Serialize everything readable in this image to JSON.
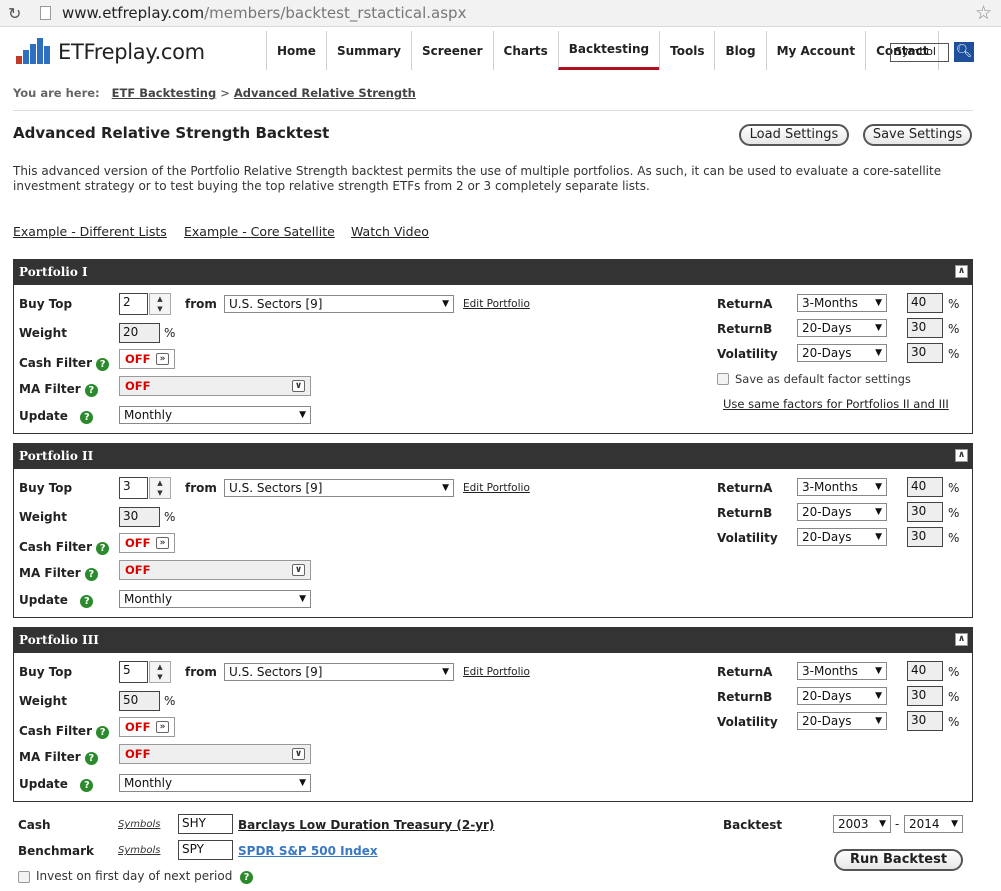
{
  "browser": {
    "url_host": "www.etfreplay.com",
    "url_path": "/members/backtest_rstactical.aspx"
  },
  "header": {
    "logo_text": "ETFreplay.com",
    "nav": [
      "Home",
      "Summary",
      "Screener",
      "Charts",
      "Backtesting",
      "Tools",
      "Blog",
      "My Account",
      "Contact"
    ],
    "active_nav": "Backtesting",
    "symbol_value": "Symbol"
  },
  "breadcrumb": {
    "prefix": "You are here:",
    "item1": "ETF Backtesting",
    "sep": ">",
    "item2": "Advanced Relative Strength"
  },
  "page": {
    "title": "Advanced Relative Strength Backtest",
    "load_label": "Load Settings",
    "save_label": "Save Settings",
    "description": "This advanced version of the Portfolio Relative Strength backtest permits the use of multiple portfolios. As such, it can be used to evaluate a core-satellite investment strategy or to test buying the top relative strength ETFs from 2 or 3 completely separate lists.",
    "example1": "Example - Different Lists",
    "example2": "Example - Core Satellite",
    "video": "Watch Video"
  },
  "labels": {
    "buy_top": "Buy Top",
    "from": "from",
    "weight": "Weight",
    "cash_filter": "Cash Filter",
    "ma_filter": "MA Filter",
    "update": "Update",
    "edit_portfolio": "Edit Portfolio",
    "returnA": "ReturnA",
    "returnB": "ReturnB",
    "volatility": "Volatility",
    "pct": "%",
    "off": "OFF",
    "save_default": "Save as default factor settings",
    "use_same": "Use same factors for Portfolios II and III"
  },
  "portfolios": [
    {
      "name": "Portfolio I",
      "buy_top": "2",
      "list": "U.S. Sectors [9]",
      "weight": "20",
      "update": "Monthly",
      "returnA_period": "3-Months",
      "returnA_weight": "40",
      "returnB_period": "20-Days",
      "returnB_weight": "30",
      "vol_period": "20-Days",
      "vol_weight": "30"
    },
    {
      "name": "Portfolio II",
      "buy_top": "3",
      "list": "U.S. Sectors [9]",
      "weight": "30",
      "update": "Monthly",
      "returnA_period": "3-Months",
      "returnA_weight": "40",
      "returnB_period": "20-Days",
      "returnB_weight": "30",
      "vol_period": "20-Days",
      "vol_weight": "30"
    },
    {
      "name": "Portfolio III",
      "buy_top": "5",
      "list": "U.S. Sectors [9]",
      "weight": "50",
      "update": "Monthly",
      "returnA_period": "3-Months",
      "returnA_weight": "40",
      "returnB_period": "20-Days",
      "returnB_weight": "30",
      "vol_period": "20-Days",
      "vol_weight": "30"
    }
  ],
  "bottom": {
    "cash_label": "Cash",
    "benchmark_label": "Benchmark",
    "symbols_link": "Symbols",
    "cash_symbol": "SHY",
    "cash_name": "Barclays Low Duration Treasury (2-yr)",
    "bench_symbol": "SPY",
    "bench_name": "SPDR S&P 500 Index",
    "invest_label": "Invest on first day of next period",
    "backtest_label": "Backtest",
    "start_year": "2003",
    "dash": "-",
    "end_year": "2014",
    "run_label": "Run Backtest"
  },
  "colors": {
    "nav_active_underline": "#b01020",
    "panel_header": "#333333",
    "off_text": "#dd0000",
    "help_icon": "#2b8a2b",
    "search_button": "#1d4f9b",
    "bench_link": "#3a78c2",
    "logo_bars": [
      "#c0392b",
      "#2e6fbf",
      "#2e6fbf",
      "#2e6fbf",
      "#2e6fbf"
    ]
  }
}
